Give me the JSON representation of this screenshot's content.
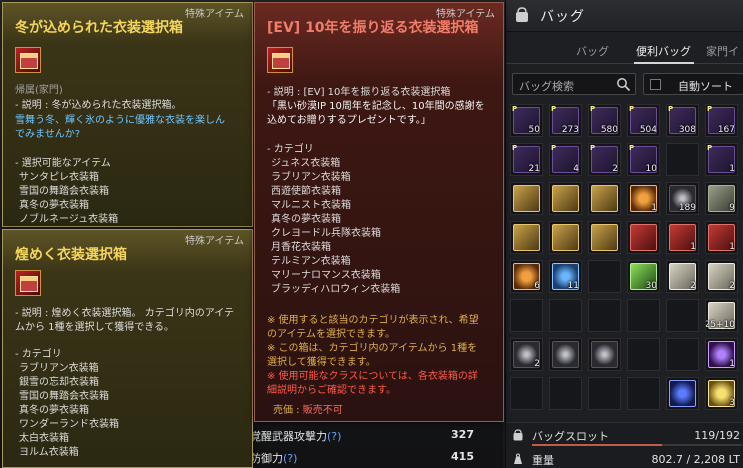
{
  "stats": {
    "awaken_label": "覚醒武器攻撃力",
    "awaken_value": "327",
    "defense_label": "防御力",
    "defense_value": "415",
    "question_mark": "(?)",
    "ghost_value": "189"
  },
  "bag": {
    "title": "バッグ",
    "tabs": [
      {
        "label": "バッグ",
        "active": false
      },
      {
        "label": "便利バッグ",
        "active": true
      },
      {
        "label": "家門イ",
        "active": false
      }
    ],
    "search_placeholder": "バッグ検索",
    "autosort_label": "自動ソート",
    "slot_label": "バッグスロット",
    "slot_value": "119/192",
    "slot_fill": 0.62,
    "weight_label": "重量",
    "weight_value": "802.7 / 2,208 LT",
    "slots": [
      {
        "icon": "box",
        "count": "50",
        "p": true
      },
      {
        "icon": "box",
        "count": "273",
        "p": true
      },
      {
        "icon": "box",
        "count": "580",
        "p": true
      },
      {
        "icon": "box",
        "count": "504",
        "p": true
      },
      {
        "icon": "box",
        "count": "308",
        "p": true
      },
      {
        "icon": "box",
        "count": "167",
        "p": true
      },
      {
        "icon": "box",
        "count": "21",
        "p": true
      },
      {
        "icon": "box",
        "count": "4",
        "p": true
      },
      {
        "icon": "box",
        "count": "2",
        "p": true
      },
      {
        "icon": "box",
        "count": "10",
        "p": true
      },
      {
        "icon": "empty",
        "count": ""
      },
      {
        "icon": "box",
        "count": "1",
        "p": true
      },
      {
        "icon": "gold",
        "count": ""
      },
      {
        "icon": "gold",
        "count": ""
      },
      {
        "icon": "gold",
        "count": ""
      },
      {
        "icon": "orange",
        "count": "1"
      },
      {
        "icon": "dark",
        "count": "189"
      },
      {
        "icon": "stone",
        "count": "9"
      },
      {
        "icon": "gold",
        "count": ""
      },
      {
        "icon": "gold",
        "count": ""
      },
      {
        "icon": "gold",
        "count": ""
      },
      {
        "icon": "red",
        "count": ""
      },
      {
        "icon": "red",
        "count": "1"
      },
      {
        "icon": "red",
        "count": "1"
      },
      {
        "icon": "orange",
        "count": "6"
      },
      {
        "icon": "blue",
        "count": "11"
      },
      {
        "icon": "empty",
        "count": ""
      },
      {
        "icon": "green",
        "count": "30"
      },
      {
        "icon": "paper",
        "count": "2"
      },
      {
        "icon": "paper",
        "count": "2"
      },
      {
        "icon": "empty",
        "count": ""
      },
      {
        "icon": "empty",
        "count": ""
      },
      {
        "icon": "empty",
        "count": ""
      },
      {
        "icon": "empty",
        "count": ""
      },
      {
        "icon": "empty",
        "count": ""
      },
      {
        "icon": "paper",
        "count": "25+10"
      },
      {
        "icon": "dark",
        "count": "2"
      },
      {
        "icon": "dark",
        "count": ""
      },
      {
        "icon": "dark",
        "count": ""
      },
      {
        "icon": "empty",
        "count": ""
      },
      {
        "icon": "empty",
        "count": ""
      },
      {
        "icon": "purple",
        "count": "1"
      },
      {
        "icon": "empty",
        "count": ""
      },
      {
        "icon": "empty",
        "count": ""
      },
      {
        "icon": "empty",
        "count": ""
      },
      {
        "icon": "empty",
        "count": ""
      },
      {
        "icon": "navy",
        "count": ""
      },
      {
        "icon": "yellow",
        "count": "3"
      }
    ]
  },
  "tooltip_winter": {
    "category": "特殊アイテム",
    "title": "冬が込められた衣装選択箱",
    "binding": "帰属(家門)",
    "desc_label": "- 説明 : 冬が込められた衣装選択箱。",
    "desc_blue_1": "雪舞う冬、輝く氷のように優雅な衣装を楽しん",
    "desc_blue_2": "でみませんか?",
    "choices_header": "- 選択可能なアイテム",
    "items": [
      "サンタピレ衣装箱",
      "雪国の舞踏会衣装箱",
      "真冬の夢衣装箱",
      "ノブルネージュ衣装箱"
    ]
  },
  "tooltip_radiant": {
    "category": "特殊アイテム",
    "title": "煌めく衣装選択箱",
    "desc_1": "- 説明 : 煌めく衣装選択箱。 カテゴリ内のアイテ",
    "desc_2": "ムから 1種を選択して獲得できる。",
    "cat_header": "- カテゴリ",
    "items": [
      "ラブリアン衣装箱",
      "銀雪の忘却衣装箱",
      "雪国の舞踏会衣装箱",
      "真冬の夢衣装箱",
      "ワンダーランド衣装箱",
      "太白衣装箱",
      "ヨルム衣装箱"
    ]
  },
  "tooltip_ev": {
    "category": "特殊アイテム",
    "title": "[EV] 10年を振り返る衣装選択箱",
    "desc_1": "- 説明 : [EV] 10年を振り返る衣装選択箱",
    "desc_2": "「黒い砂漠IP 10周年を記念し、10年間の感謝を",
    "desc_3": "込めてお贈りするプレゼントです。」",
    "cat_header": "- カテゴリ",
    "items": [
      "ジュネス衣装箱",
      "ラブリアン衣装箱",
      "西遊使節衣装箱",
      "マルニスト衣装箱",
      "真冬の夢衣装箱",
      "クレヨードル兵隊衣装箱",
      "月香花衣装箱",
      "テルミアン衣装箱",
      "マリーナロマンス衣装箱",
      "ブラッディハロウィン衣装箱"
    ],
    "note_1": "※ 使用すると該当のカテゴリが表示され、希望",
    "note_2": "のアイテムを選択できます。",
    "note_3": "※ この箱は、カテゴリ内のアイテムから 1種を",
    "note_4": "選択して獲得できます。",
    "warn_1": "※ 使用可能なクラスについては、各衣装箱の詳",
    "warn_2": "細説明からご確認できます。",
    "sale_label": "売価 : ",
    "sale_value": "販売不可"
  }
}
